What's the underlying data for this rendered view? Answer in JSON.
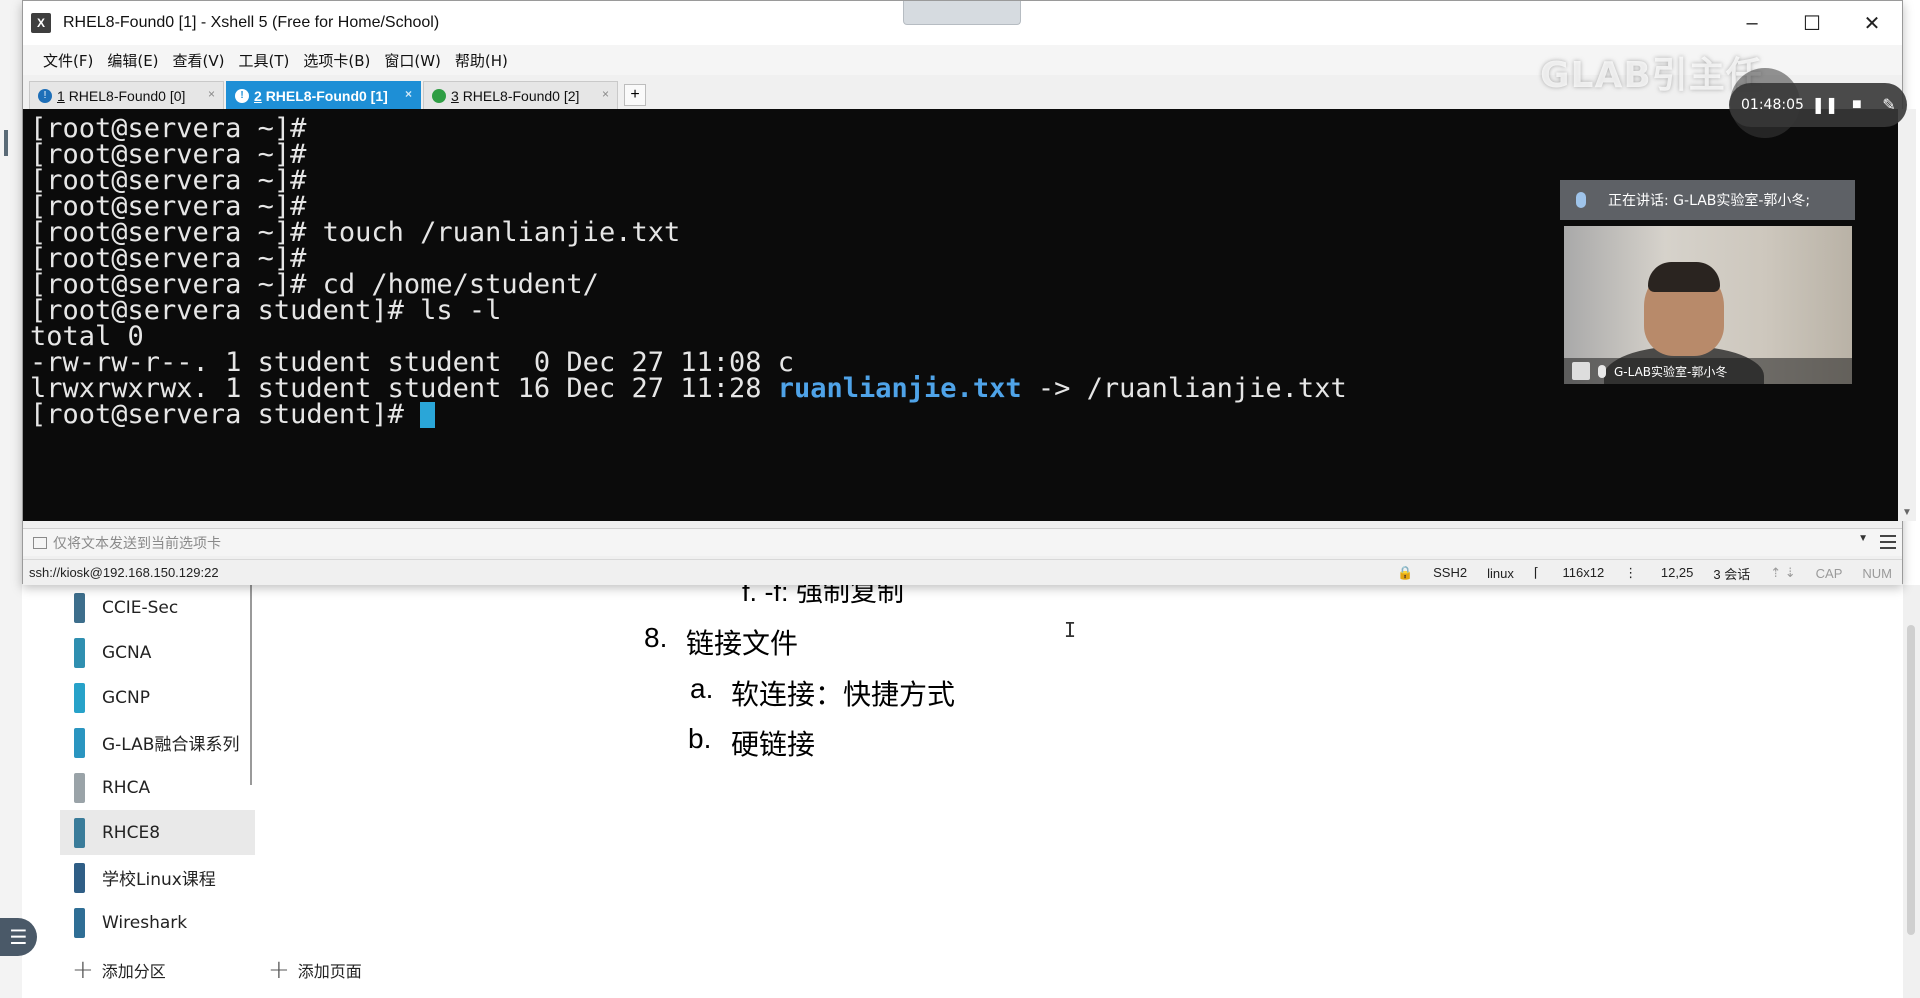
{
  "xshell": {
    "title": "RHEL8-Found0 [1] - Xshell 5 (Free for Home/School)",
    "menu": [
      "文件(F)",
      "编辑(E)",
      "查看(V)",
      "工具(T)",
      "选项卡(B)",
      "窗口(W)",
      "帮助(H)"
    ],
    "tabs": [
      {
        "num": "1",
        "label": "RHEL8-Found0 [0]"
      },
      {
        "num": "2",
        "label": "RHEL8-Found0 [1]"
      },
      {
        "num": "3",
        "label": "RHEL8-Found0 [2]"
      }
    ],
    "tab_add": "+",
    "send_placeholder": "仅将文本发送到当前选项卡",
    "status": {
      "connection": "ssh://kiosk@192.168.150.129:22",
      "protocol": "SSH2",
      "term": "linux",
      "size": "116x12",
      "cursor": "12,25",
      "sessions": "3 会话",
      "cap": "CAP",
      "num": "NUM"
    }
  },
  "terminal": {
    "lines": [
      "[root@servera ~]#",
      "[root@servera ~]#",
      "[root@servera ~]#",
      "[root@servera ~]#",
      "[root@servera ~]# touch /ruanlianjie.txt",
      "[root@servera ~]#",
      "[root@servera ~]# cd /home/student/",
      "[root@servera student]# ls -l",
      "total 0",
      "-rw-rw-r--. 1 student student  0 Dec 27 11:08 c"
    ],
    "symlink_line": {
      "prefix": "lrwxrwxrwx. 1 student student 16 Dec 27 11:28 ",
      "link": "ruanlianjie.txt",
      "suffix": " -> /ruanlianjie.txt"
    },
    "prompt": "[root@servera student]# "
  },
  "overlay": {
    "watermark": "GLAB引主任",
    "record_time": "01:48:05",
    "speaking": "正在讲话: G-LAB实验室-郭小冬;",
    "video_name": "G-LAB实验室-郭小冬"
  },
  "notebook": {
    "sections": [
      {
        "label": "CCIE-Sec",
        "color": "#3d6e8c"
      },
      {
        "label": "GCNA",
        "color": "#2f8fb0"
      },
      {
        "label": "GCNP",
        "color": "#27a2c9"
      },
      {
        "label": "G-LAB融合课系列",
        "color": "#2a95c0"
      },
      {
        "label": "RHCA",
        "color": "#9aa3a8"
      },
      {
        "label": "RHCE8",
        "color": "#3a7c9a"
      },
      {
        "label": "学校Linux课程",
        "color": "#2f5e86"
      },
      {
        "label": "Wireshark",
        "color": "#2f6e95"
      }
    ],
    "add_section": "添加分区",
    "add_page": "添加页面",
    "content": {
      "partial_line": "f.  -f:  强制复制",
      "heading_num": "8.",
      "heading": "链接文件",
      "item_a_label": "a.",
      "item_a": "软连接：快捷方式",
      "item_b_label": "b.",
      "item_b": "硬链接"
    }
  }
}
